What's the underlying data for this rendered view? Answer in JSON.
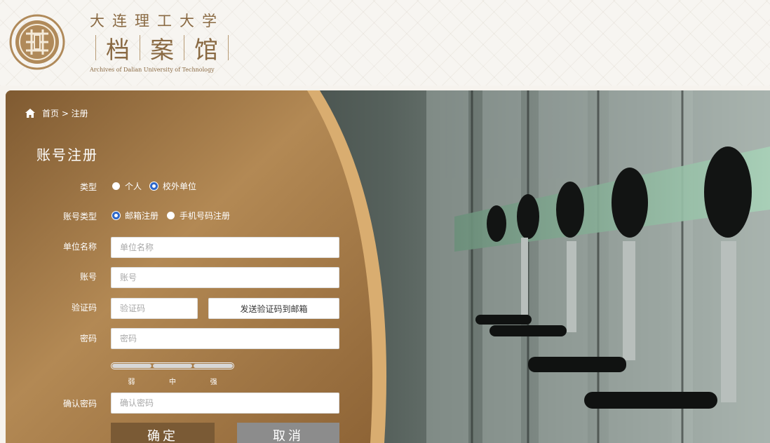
{
  "header": {
    "title_small": "大连理工大学",
    "title_big": [
      "档",
      "案",
      "馆"
    ],
    "title_en": "Archives of Dalian University of Technology",
    "logo_icon": "archive-seal-logo"
  },
  "breadcrumb": {
    "home_icon": "home-icon",
    "text": "首页 > 注册"
  },
  "form": {
    "title": "账号注册",
    "type": {
      "label": "类型",
      "options": [
        {
          "label": "个人",
          "selected": false
        },
        {
          "label": "校外单位",
          "selected": true
        }
      ]
    },
    "account_type": {
      "label": "账号类型",
      "options": [
        {
          "label": "邮箱注册",
          "selected": true
        },
        {
          "label": "手机号码注册",
          "selected": false
        }
      ]
    },
    "unit_name": {
      "label": "单位名称",
      "placeholder": "单位名称",
      "value": ""
    },
    "account": {
      "label": "账号",
      "placeholder": "账号",
      "value": ""
    },
    "captcha": {
      "label": "验证码",
      "placeholder": "验证码",
      "value": "",
      "send_button": "发送验证码到邮箱"
    },
    "password": {
      "label": "密码",
      "placeholder": "密码",
      "value": ""
    },
    "strength": {
      "labels": [
        "弱",
        "中",
        "强"
      ]
    },
    "confirm_password": {
      "label": "确认密码",
      "placeholder": "确认密码",
      "value": ""
    },
    "confirm_button": "确定",
    "cancel_button": "取消"
  },
  "colors": {
    "brand_gold": "#8a6a43",
    "panel_gold": "#a77e45",
    "confirm_button_bg": "#7a5a35",
    "cancel_button_bg": "#8c8c8c",
    "radio_selected": "#2f68c9"
  }
}
